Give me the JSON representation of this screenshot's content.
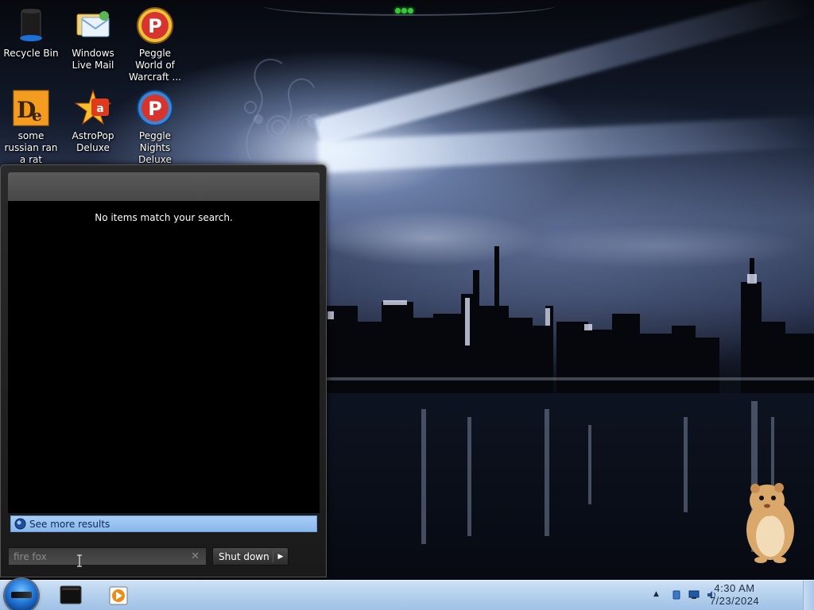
{
  "desktop": {
    "icons": [
      {
        "label": "Recycle Bin",
        "icon": "recycle-bin-icon"
      },
      {
        "label": "Windows Live Mail",
        "icon": "windows-live-mail-icon"
      },
      {
        "label": "Peggle World of Warcraft ...",
        "icon": "peggle-icon"
      },
      {
        "label": "some russian ran a rat",
        "icon": "de-app-icon"
      },
      {
        "label": "AstroPop Deluxe",
        "icon": "astropop-icon"
      },
      {
        "label": "Peggle Nights Deluxe",
        "icon": "peggle-nights-icon"
      }
    ]
  },
  "start_menu": {
    "no_results_text": "No items match your search.",
    "see_more_label": "See more results",
    "search": {
      "value": "fire fox",
      "clear_glyph": "✕"
    },
    "shutdown_label": "Shut down",
    "shutdown_arrow": "▶"
  },
  "taskbar": {
    "pinned": [
      "terminal-icon",
      "media-player-icon"
    ],
    "tray": {
      "overflow_glyph": "▲",
      "time": "4:30 AM",
      "date": "7/23/2024"
    }
  },
  "colors": {
    "see_more_bg": "#97c2f1",
    "taskbar_bg": "#b7d2ee",
    "menu_bg": "#1f1f1f"
  }
}
